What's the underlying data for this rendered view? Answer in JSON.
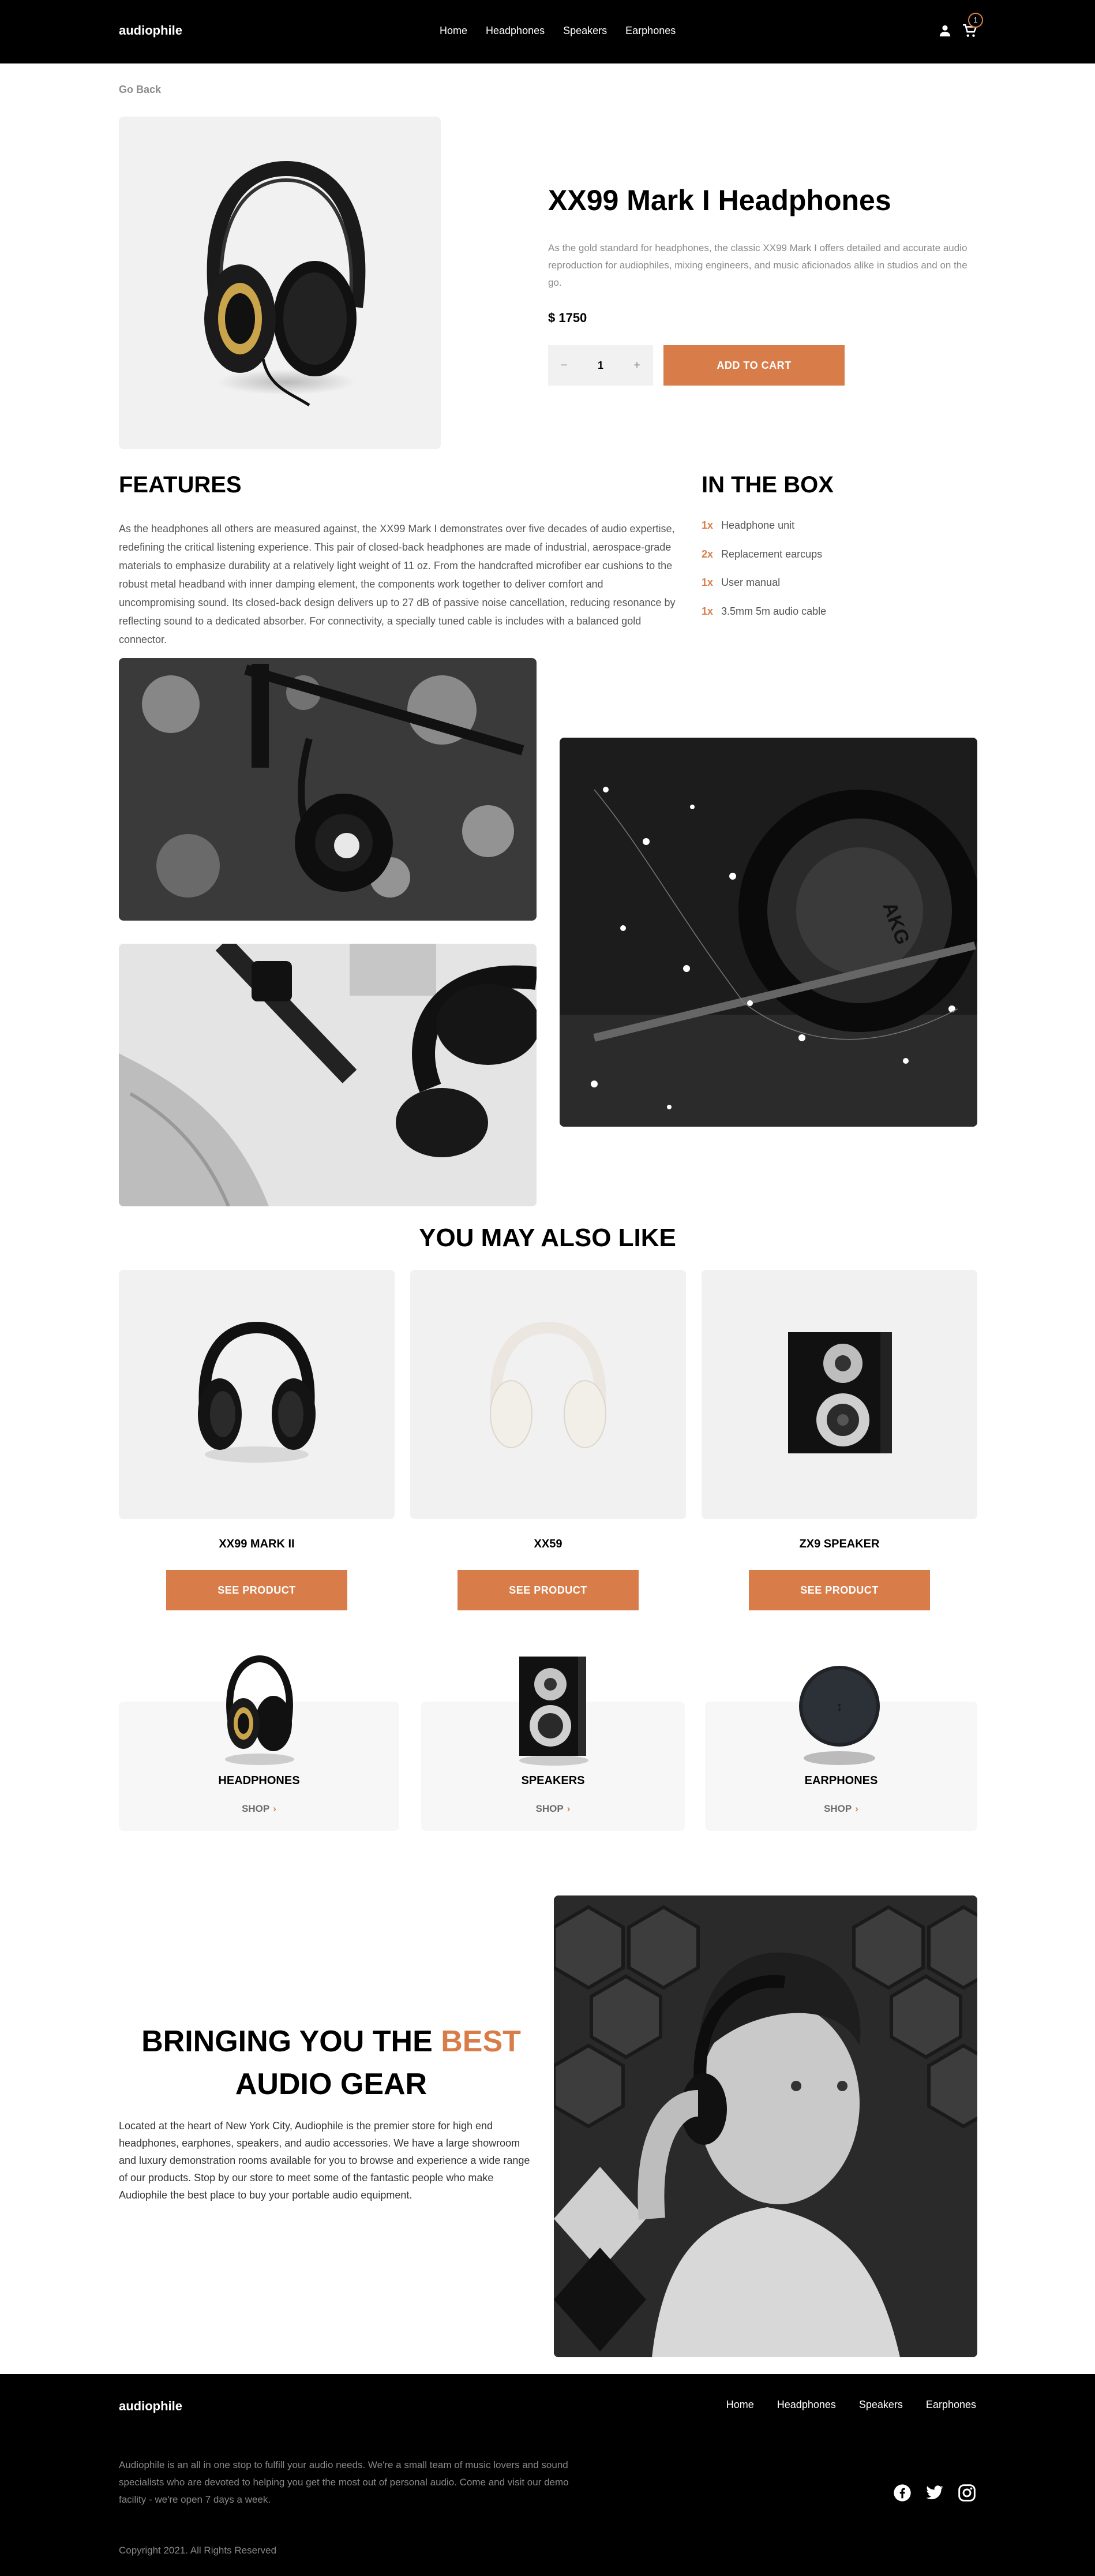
{
  "brand": "audiophile",
  "nav": [
    "Home",
    "Headphones",
    "Speakers",
    "Earphones"
  ],
  "cart_count": "1",
  "go_back": "Go Back",
  "product": {
    "title": "XX99 Mark I Headphones",
    "description": "As the gold standard for headphones, the classic XX99 Mark I offers detailed and accurate audio reproduction for audiophiles, mixing engineers, and music aficionados alike in studios and on the go.",
    "price": "$ 1750",
    "quantity": "1",
    "minus": "−",
    "plus": "+",
    "add_to_cart": "ADD TO CART"
  },
  "features": {
    "title": "FEATURES",
    "text": "As the headphones all others are measured against, the XX99 Mark I demonstrates over five decades of audio expertise, redefining the critical listening experience. This pair of closed-back headphones are made of industrial, aerospace-grade materials to emphasize durability at a relatively light weight of 11 oz. From the handcrafted microfiber ear cushions to the robust metal headband with inner damping element, the components work together to deliver comfort and uncompromising sound. Its closed-back design delivers up to 27 dB of passive noise cancellation, reducing resonance by reflecting sound to a dedicated absorber. For connectivity, a specially tuned cable is includes with a balanced gold connector."
  },
  "in_the_box": {
    "title": "IN THE BOX",
    "items": [
      {
        "qty": "1x",
        "name": "Headphone unit"
      },
      {
        "qty": "2x",
        "name": "Replacement earcups"
      },
      {
        "qty": "1x",
        "name": "User manual"
      },
      {
        "qty": "1x",
        "name": "3.5mm 5m audio cable"
      }
    ]
  },
  "you_may_also_like": {
    "title": "YOU MAY ALSO LIKE",
    "items": [
      {
        "name": "XX99 MARK II",
        "button": "SEE PRODUCT"
      },
      {
        "name": "XX59",
        "button": "SEE PRODUCT"
      },
      {
        "name": "ZX9 SPEAKER",
        "button": "SEE PRODUCT"
      }
    ]
  },
  "categories": [
    {
      "name": "HEADPHONES",
      "link": "SHOP"
    },
    {
      "name": "SPEAKERS",
      "link": "SHOP"
    },
    {
      "name": "EARPHONES",
      "link": "SHOP"
    }
  ],
  "about": {
    "title_part1": "BRINGING YOU THE ",
    "title_highlight": "BEST",
    "title_part2": "AUDIO GEAR",
    "text": "Located at the heart of New York City, Audiophile is the premier store for high end headphones, earphones, speakers, and audio accessories. We have a large showroom and luxury demonstration rooms available for you to browse and experience a wide range of our products. Stop by our store to meet some of the fantastic people who make Audiophile the best place to buy your portable audio equipment."
  },
  "footer": {
    "text": "Audiophile is an all in one stop to fulfill your audio needs. We're a small team of music lovers and sound specialists who are devoted to helping you get the most out of personal audio. Come and visit our demo facility - we're open 7 days a week.",
    "copyright": "Copyright 2021. All Rights Reserved"
  },
  "colors": {
    "accent": "#d87d4a",
    "dark": "#000000",
    "light_gray": "#f1f1f1"
  },
  "icons": [
    "user-icon",
    "cart-icon",
    "chevron-right-icon",
    "facebook-icon",
    "twitter-icon",
    "instagram-icon"
  ]
}
